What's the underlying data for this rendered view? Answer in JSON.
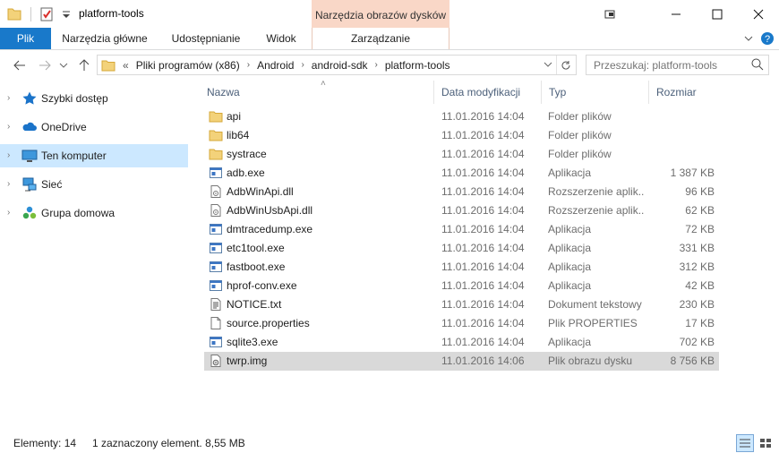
{
  "window": {
    "title": "platform-tools",
    "context_tab_group": "Narzędzia obrazów dysków",
    "accent_color": "#1979ca",
    "context_color": "#f9d7c7"
  },
  "ribbon": {
    "tabs": [
      "Plik",
      "Narzędzia główne",
      "Udostępnianie",
      "Widok",
      "Zarządzanie"
    ]
  },
  "address": {
    "overflow": "«",
    "crumbs": [
      "Pliki programów (x86)",
      "Android",
      "android-sdk",
      "platform-tools"
    ]
  },
  "search": {
    "placeholder": "Przeszukaj: platform-tools"
  },
  "nav": {
    "items": [
      {
        "label": "Szybki dostęp",
        "icon": "star-icon"
      },
      {
        "label": "OneDrive",
        "icon": "cloud-icon"
      },
      {
        "label": "Ten komputer",
        "icon": "computer-icon",
        "selected": true
      },
      {
        "label": "Sieć",
        "icon": "network-icon"
      },
      {
        "label": "Grupa domowa",
        "icon": "homegroup-icon"
      }
    ]
  },
  "columns": [
    "Nazwa",
    "Data modyfikacji",
    "Typ",
    "Rozmiar"
  ],
  "files": [
    {
      "name": "api",
      "date": "11.01.2016 14:04",
      "type": "Folder plików",
      "size": "",
      "icon": "folder"
    },
    {
      "name": "lib64",
      "date": "11.01.2016 14:04",
      "type": "Folder plików",
      "size": "",
      "icon": "folder"
    },
    {
      "name": "systrace",
      "date": "11.01.2016 14:04",
      "type": "Folder plików",
      "size": "",
      "icon": "folder"
    },
    {
      "name": "adb.exe",
      "date": "11.01.2016 14:04",
      "type": "Aplikacja",
      "size": "1 387 KB",
      "icon": "exe"
    },
    {
      "name": "AdbWinApi.dll",
      "date": "11.01.2016 14:04",
      "type": "Rozszerzenie aplik...",
      "size": "96 KB",
      "icon": "dll"
    },
    {
      "name": "AdbWinUsbApi.dll",
      "date": "11.01.2016 14:04",
      "type": "Rozszerzenie aplik...",
      "size": "62 KB",
      "icon": "dll"
    },
    {
      "name": "dmtracedump.exe",
      "date": "11.01.2016 14:04",
      "type": "Aplikacja",
      "size": "72 KB",
      "icon": "exe"
    },
    {
      "name": "etc1tool.exe",
      "date": "11.01.2016 14:04",
      "type": "Aplikacja",
      "size": "331 KB",
      "icon": "exe"
    },
    {
      "name": "fastboot.exe",
      "date": "11.01.2016 14:04",
      "type": "Aplikacja",
      "size": "312 KB",
      "icon": "exe"
    },
    {
      "name": "hprof-conv.exe",
      "date": "11.01.2016 14:04",
      "type": "Aplikacja",
      "size": "42 KB",
      "icon": "exe"
    },
    {
      "name": "NOTICE.txt",
      "date": "11.01.2016 14:04",
      "type": "Dokument tekstowy",
      "size": "230 KB",
      "icon": "txt"
    },
    {
      "name": "source.properties",
      "date": "11.01.2016 14:04",
      "type": "Plik PROPERTIES",
      "size": "17 KB",
      "icon": "file"
    },
    {
      "name": "sqlite3.exe",
      "date": "11.01.2016 14:04",
      "type": "Aplikacja",
      "size": "702 KB",
      "icon": "exe"
    },
    {
      "name": "twrp.img",
      "date": "11.01.2016 14:06",
      "type": "Plik obrazu dysku",
      "size": "8 756 KB",
      "icon": "img",
      "selected": true
    }
  ],
  "status": {
    "count": "Elementy: 14",
    "selection": "1 zaznaczony element. 8,55 MB"
  }
}
